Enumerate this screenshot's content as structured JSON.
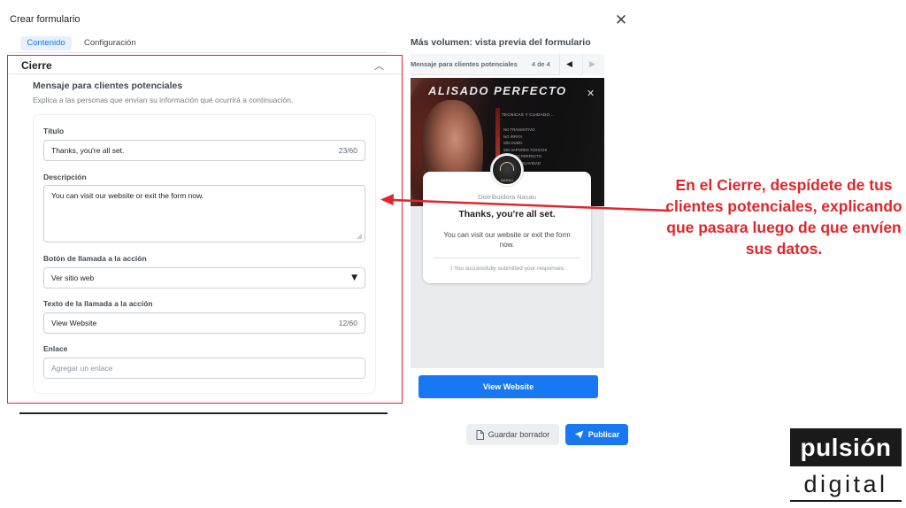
{
  "header": {
    "title": "Crear formulario",
    "close_icon": "close-icon"
  },
  "tabs": [
    {
      "label": "Contenido",
      "active": true
    },
    {
      "label": "Configuración",
      "active": false
    }
  ],
  "section": {
    "title": "Cierre",
    "subtitle": "Mensaje para clientes potenciales",
    "description": "Explica a las personas que envían su información qué ocurrirá a continuación.",
    "fields": {
      "titulo": {
        "label": "Título",
        "value": "Thanks, you're all set.",
        "counter": "23/60"
      },
      "descripcion": {
        "label": "Descripción",
        "value": "You can visit our website or exit the form now."
      },
      "boton": {
        "label": "Botón de llamada a la acción",
        "value": "Ver sitio web"
      },
      "texto": {
        "label": "Texto de la llamada a la acción",
        "value": "View Website",
        "counter": "12/60"
      },
      "enlace": {
        "label": "Enlace",
        "placeholder": "Agregar un enlace"
      }
    }
  },
  "preview": {
    "title": "Más volumen: vista previa del formulario",
    "bar_label": "Mensaje para clientes potenciales",
    "page_indicator": "4 de 4",
    "prev_icon": "triangle-left-icon",
    "next_icon": "triangle-right-icon",
    "hero": {
      "title": "ALISADO PERFECTO",
      "tagline": "TECNICAS Y CUIDADO...",
      "list": [
        "NO TRAUMATIVO",
        "NO IRRITA",
        "SIN HUMO",
        "SIN VAPORES TOXICOS",
        "ALISADO PERFECTO",
        "BRILLO Y SUAVIDAD"
      ],
      "avatar_text": "NASAU"
    },
    "company": "Distribuidora Nasau",
    "end_title": "Thanks, you're all set.",
    "end_description": "You can visit our website or exit the form now.",
    "end_note": "You successfully submitted your responses.",
    "cta_label": "View Website"
  },
  "footer": {
    "draft_label": "Guardar borrador",
    "publish_label": "Publicar"
  },
  "annotation": {
    "text": "En el Cierre, despídete de tus clientes potenciales, explicando que pasara luego de que envíen sus datos.",
    "color": "#e0262c"
  },
  "logo": {
    "top": "pulsión",
    "bottom": "digital"
  },
  "colors": {
    "accent": "#1877f2",
    "highlight": "#e0262c"
  }
}
